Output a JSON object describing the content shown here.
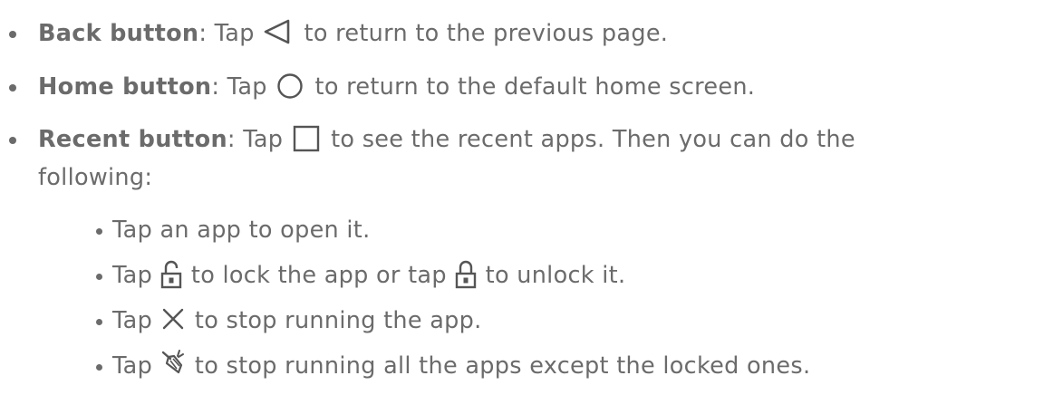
{
  "items": [
    {
      "bold": "Back button",
      "pre": ": Tap ",
      "icon": "back-triangle-icon",
      "post": " to return to the previous page."
    },
    {
      "bold": "Home button",
      "pre": ": Tap ",
      "icon": "home-circle-icon",
      "post": " to return to the default home screen."
    },
    {
      "bold": "Recent button",
      "pre": ": Tap ",
      "icon": "recent-square-icon",
      "post": " to see the recent apps. Then you can do the",
      "cont": "following:"
    }
  ],
  "subitems": [
    {
      "text": "Tap an app to open it."
    },
    {
      "pre": "Tap ",
      "icon1": "unlocked-padlock-icon",
      "mid": " to lock the app or tap ",
      "icon2": "locked-padlock-icon",
      "post": " to unlock it."
    },
    {
      "pre": "Tap ",
      "icon": "close-x-icon",
      "post": " to stop running the app."
    },
    {
      "pre": "Tap ",
      "icon": "broom-icon",
      "post": " to stop running all the apps except the locked ones."
    }
  ]
}
